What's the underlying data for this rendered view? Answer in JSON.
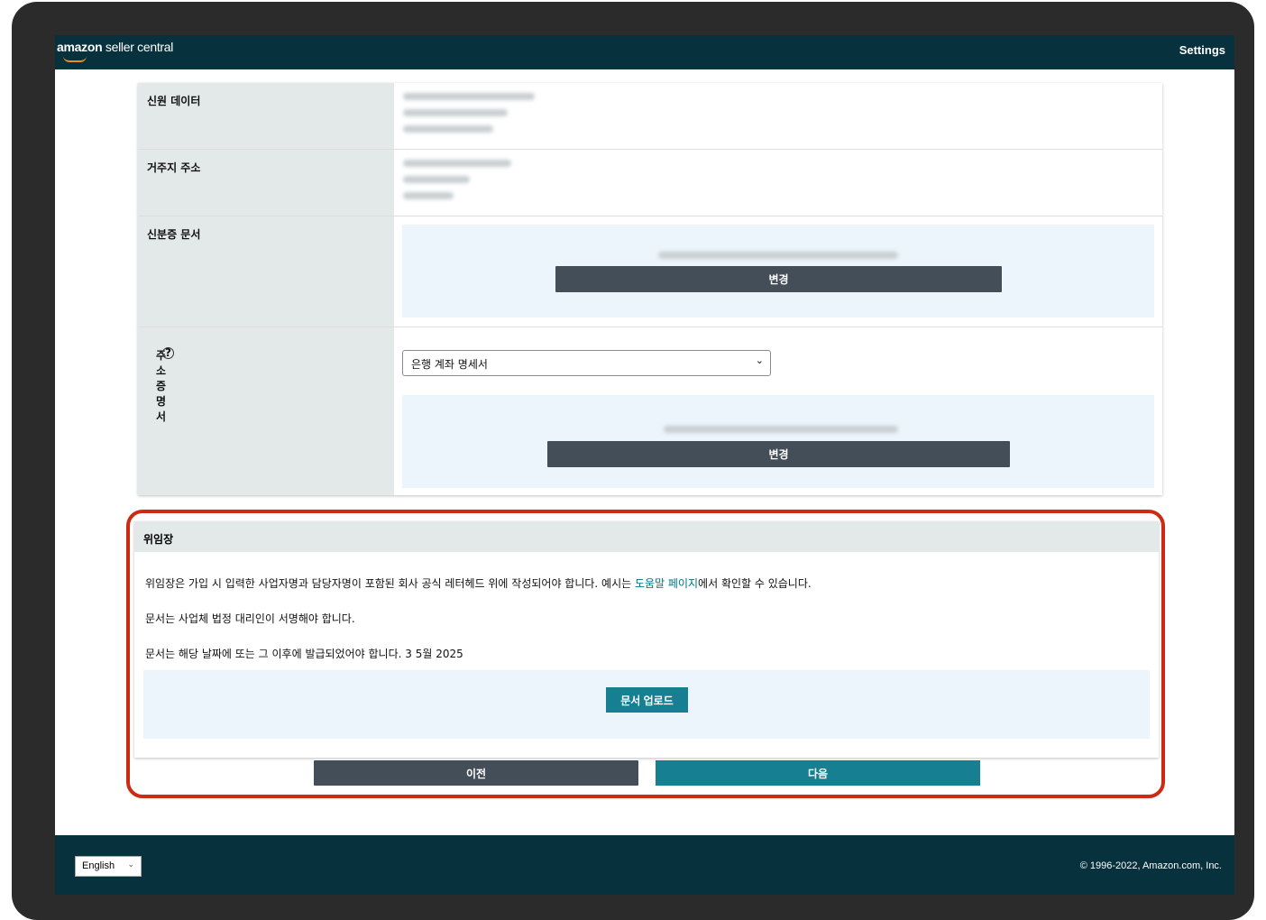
{
  "header": {
    "logo_brand": "amazon",
    "logo_rest": " seller central",
    "settings_label": "Settings"
  },
  "sections": {
    "identity_data": {
      "label": "신원 데이터"
    },
    "residence_address": {
      "label": "거주지 주소"
    },
    "id_document": {
      "label": "신분증 문서",
      "change_label": "변경"
    },
    "proof_of_address": {
      "label": "주소 증명서",
      "help_icon": "circle-question-icon",
      "select_value": "은행 계좌 명세서",
      "change_label": "변경"
    }
  },
  "power_of_attorney": {
    "title": "위임장",
    "line1_before": "위임장은 가입 시 입력한 사업자명과 담당자명이 포함된 회사 공식 레터헤드 위에 작성되어야 합니다. 예시는 ",
    "line1_link": "도움말 페이지",
    "line1_after": "에서 확인할 수 있습니다.",
    "line2": "문서는 사업체 법정 대리인이 서명해야 합니다.",
    "line3": "문서는 해당 날짜에 또는 그 이후에 발급되었어야 합니다. 3 5월 2025",
    "upload_label": "문서 업로드"
  },
  "nav": {
    "prev_label": "이전",
    "next_label": "다음"
  },
  "footer": {
    "language": "English",
    "copyright": "© 1996-2022, Amazon.com, Inc."
  },
  "colors": {
    "header_bg": "#07313d",
    "teal": "#167f92",
    "dark_button": "#444e59",
    "highlight": "#cc2a12"
  }
}
